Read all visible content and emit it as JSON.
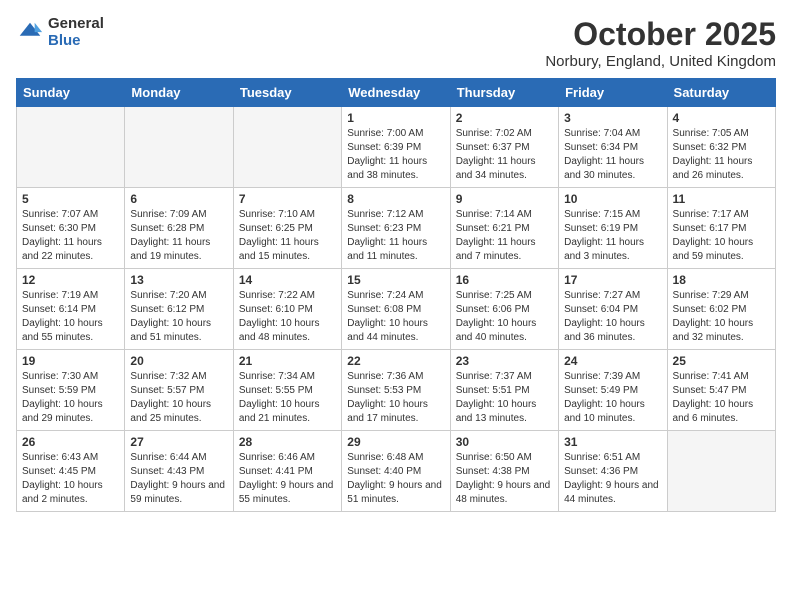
{
  "header": {
    "logo_general": "General",
    "logo_blue": "Blue",
    "month": "October 2025",
    "location": "Norbury, England, United Kingdom"
  },
  "weekdays": [
    "Sunday",
    "Monday",
    "Tuesday",
    "Wednesday",
    "Thursday",
    "Friday",
    "Saturday"
  ],
  "weeks": [
    [
      {
        "day": "",
        "empty": true
      },
      {
        "day": "",
        "empty": true
      },
      {
        "day": "",
        "empty": true
      },
      {
        "day": "1",
        "sunrise": "Sunrise: 7:00 AM",
        "sunset": "Sunset: 6:39 PM",
        "daylight": "Daylight: 11 hours and 38 minutes."
      },
      {
        "day": "2",
        "sunrise": "Sunrise: 7:02 AM",
        "sunset": "Sunset: 6:37 PM",
        "daylight": "Daylight: 11 hours and 34 minutes."
      },
      {
        "day": "3",
        "sunrise": "Sunrise: 7:04 AM",
        "sunset": "Sunset: 6:34 PM",
        "daylight": "Daylight: 11 hours and 30 minutes."
      },
      {
        "day": "4",
        "sunrise": "Sunrise: 7:05 AM",
        "sunset": "Sunset: 6:32 PM",
        "daylight": "Daylight: 11 hours and 26 minutes."
      }
    ],
    [
      {
        "day": "5",
        "sunrise": "Sunrise: 7:07 AM",
        "sunset": "Sunset: 6:30 PM",
        "daylight": "Daylight: 11 hours and 22 minutes."
      },
      {
        "day": "6",
        "sunrise": "Sunrise: 7:09 AM",
        "sunset": "Sunset: 6:28 PM",
        "daylight": "Daylight: 11 hours and 19 minutes."
      },
      {
        "day": "7",
        "sunrise": "Sunrise: 7:10 AM",
        "sunset": "Sunset: 6:25 PM",
        "daylight": "Daylight: 11 hours and 15 minutes."
      },
      {
        "day": "8",
        "sunrise": "Sunrise: 7:12 AM",
        "sunset": "Sunset: 6:23 PM",
        "daylight": "Daylight: 11 hours and 11 minutes."
      },
      {
        "day": "9",
        "sunrise": "Sunrise: 7:14 AM",
        "sunset": "Sunset: 6:21 PM",
        "daylight": "Daylight: 11 hours and 7 minutes."
      },
      {
        "day": "10",
        "sunrise": "Sunrise: 7:15 AM",
        "sunset": "Sunset: 6:19 PM",
        "daylight": "Daylight: 11 hours and 3 minutes."
      },
      {
        "day": "11",
        "sunrise": "Sunrise: 7:17 AM",
        "sunset": "Sunset: 6:17 PM",
        "daylight": "Daylight: 10 hours and 59 minutes."
      }
    ],
    [
      {
        "day": "12",
        "sunrise": "Sunrise: 7:19 AM",
        "sunset": "Sunset: 6:14 PM",
        "daylight": "Daylight: 10 hours and 55 minutes."
      },
      {
        "day": "13",
        "sunrise": "Sunrise: 7:20 AM",
        "sunset": "Sunset: 6:12 PM",
        "daylight": "Daylight: 10 hours and 51 minutes."
      },
      {
        "day": "14",
        "sunrise": "Sunrise: 7:22 AM",
        "sunset": "Sunset: 6:10 PM",
        "daylight": "Daylight: 10 hours and 48 minutes."
      },
      {
        "day": "15",
        "sunrise": "Sunrise: 7:24 AM",
        "sunset": "Sunset: 6:08 PM",
        "daylight": "Daylight: 10 hours and 44 minutes."
      },
      {
        "day": "16",
        "sunrise": "Sunrise: 7:25 AM",
        "sunset": "Sunset: 6:06 PM",
        "daylight": "Daylight: 10 hours and 40 minutes."
      },
      {
        "day": "17",
        "sunrise": "Sunrise: 7:27 AM",
        "sunset": "Sunset: 6:04 PM",
        "daylight": "Daylight: 10 hours and 36 minutes."
      },
      {
        "day": "18",
        "sunrise": "Sunrise: 7:29 AM",
        "sunset": "Sunset: 6:02 PM",
        "daylight": "Daylight: 10 hours and 32 minutes."
      }
    ],
    [
      {
        "day": "19",
        "sunrise": "Sunrise: 7:30 AM",
        "sunset": "Sunset: 5:59 PM",
        "daylight": "Daylight: 10 hours and 29 minutes."
      },
      {
        "day": "20",
        "sunrise": "Sunrise: 7:32 AM",
        "sunset": "Sunset: 5:57 PM",
        "daylight": "Daylight: 10 hours and 25 minutes."
      },
      {
        "day": "21",
        "sunrise": "Sunrise: 7:34 AM",
        "sunset": "Sunset: 5:55 PM",
        "daylight": "Daylight: 10 hours and 21 minutes."
      },
      {
        "day": "22",
        "sunrise": "Sunrise: 7:36 AM",
        "sunset": "Sunset: 5:53 PM",
        "daylight": "Daylight: 10 hours and 17 minutes."
      },
      {
        "day": "23",
        "sunrise": "Sunrise: 7:37 AM",
        "sunset": "Sunset: 5:51 PM",
        "daylight": "Daylight: 10 hours and 13 minutes."
      },
      {
        "day": "24",
        "sunrise": "Sunrise: 7:39 AM",
        "sunset": "Sunset: 5:49 PM",
        "daylight": "Daylight: 10 hours and 10 minutes."
      },
      {
        "day": "25",
        "sunrise": "Sunrise: 7:41 AM",
        "sunset": "Sunset: 5:47 PM",
        "daylight": "Daylight: 10 hours and 6 minutes."
      }
    ],
    [
      {
        "day": "26",
        "sunrise": "Sunrise: 6:43 AM",
        "sunset": "Sunset: 4:45 PM",
        "daylight": "Daylight: 10 hours and 2 minutes."
      },
      {
        "day": "27",
        "sunrise": "Sunrise: 6:44 AM",
        "sunset": "Sunset: 4:43 PM",
        "daylight": "Daylight: 9 hours and 59 minutes."
      },
      {
        "day": "28",
        "sunrise": "Sunrise: 6:46 AM",
        "sunset": "Sunset: 4:41 PM",
        "daylight": "Daylight: 9 hours and 55 minutes."
      },
      {
        "day": "29",
        "sunrise": "Sunrise: 6:48 AM",
        "sunset": "Sunset: 4:40 PM",
        "daylight": "Daylight: 9 hours and 51 minutes."
      },
      {
        "day": "30",
        "sunrise": "Sunrise: 6:50 AM",
        "sunset": "Sunset: 4:38 PM",
        "daylight": "Daylight: 9 hours and 48 minutes."
      },
      {
        "day": "31",
        "sunrise": "Sunrise: 6:51 AM",
        "sunset": "Sunset: 4:36 PM",
        "daylight": "Daylight: 9 hours and 44 minutes."
      },
      {
        "day": "",
        "empty": true
      }
    ]
  ]
}
